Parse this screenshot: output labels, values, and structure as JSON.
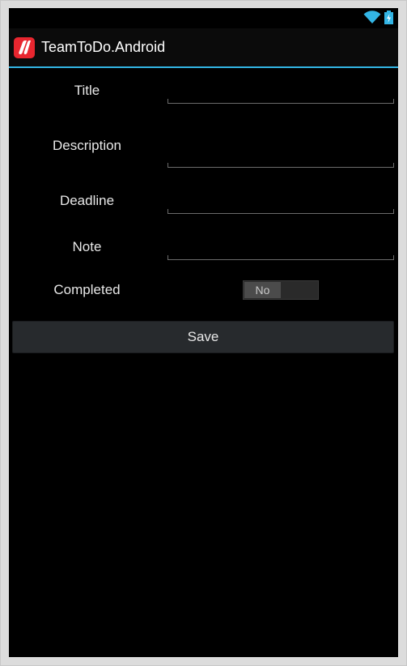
{
  "app": {
    "title": "TeamToDo.Android",
    "icon": "app-logo-icon",
    "accent_color": "#33b5e5"
  },
  "status_bar": {
    "icons": [
      "wifi-icon",
      "battery-charging-icon"
    ]
  },
  "form": {
    "fields": [
      {
        "label": "Title",
        "value": ""
      },
      {
        "label": "Description",
        "value": ""
      },
      {
        "label": "Deadline",
        "value": ""
      },
      {
        "label": "Note",
        "value": ""
      }
    ],
    "completed": {
      "label": "Completed",
      "toggle_text": "No",
      "checked": false
    },
    "save_label": "Save"
  }
}
